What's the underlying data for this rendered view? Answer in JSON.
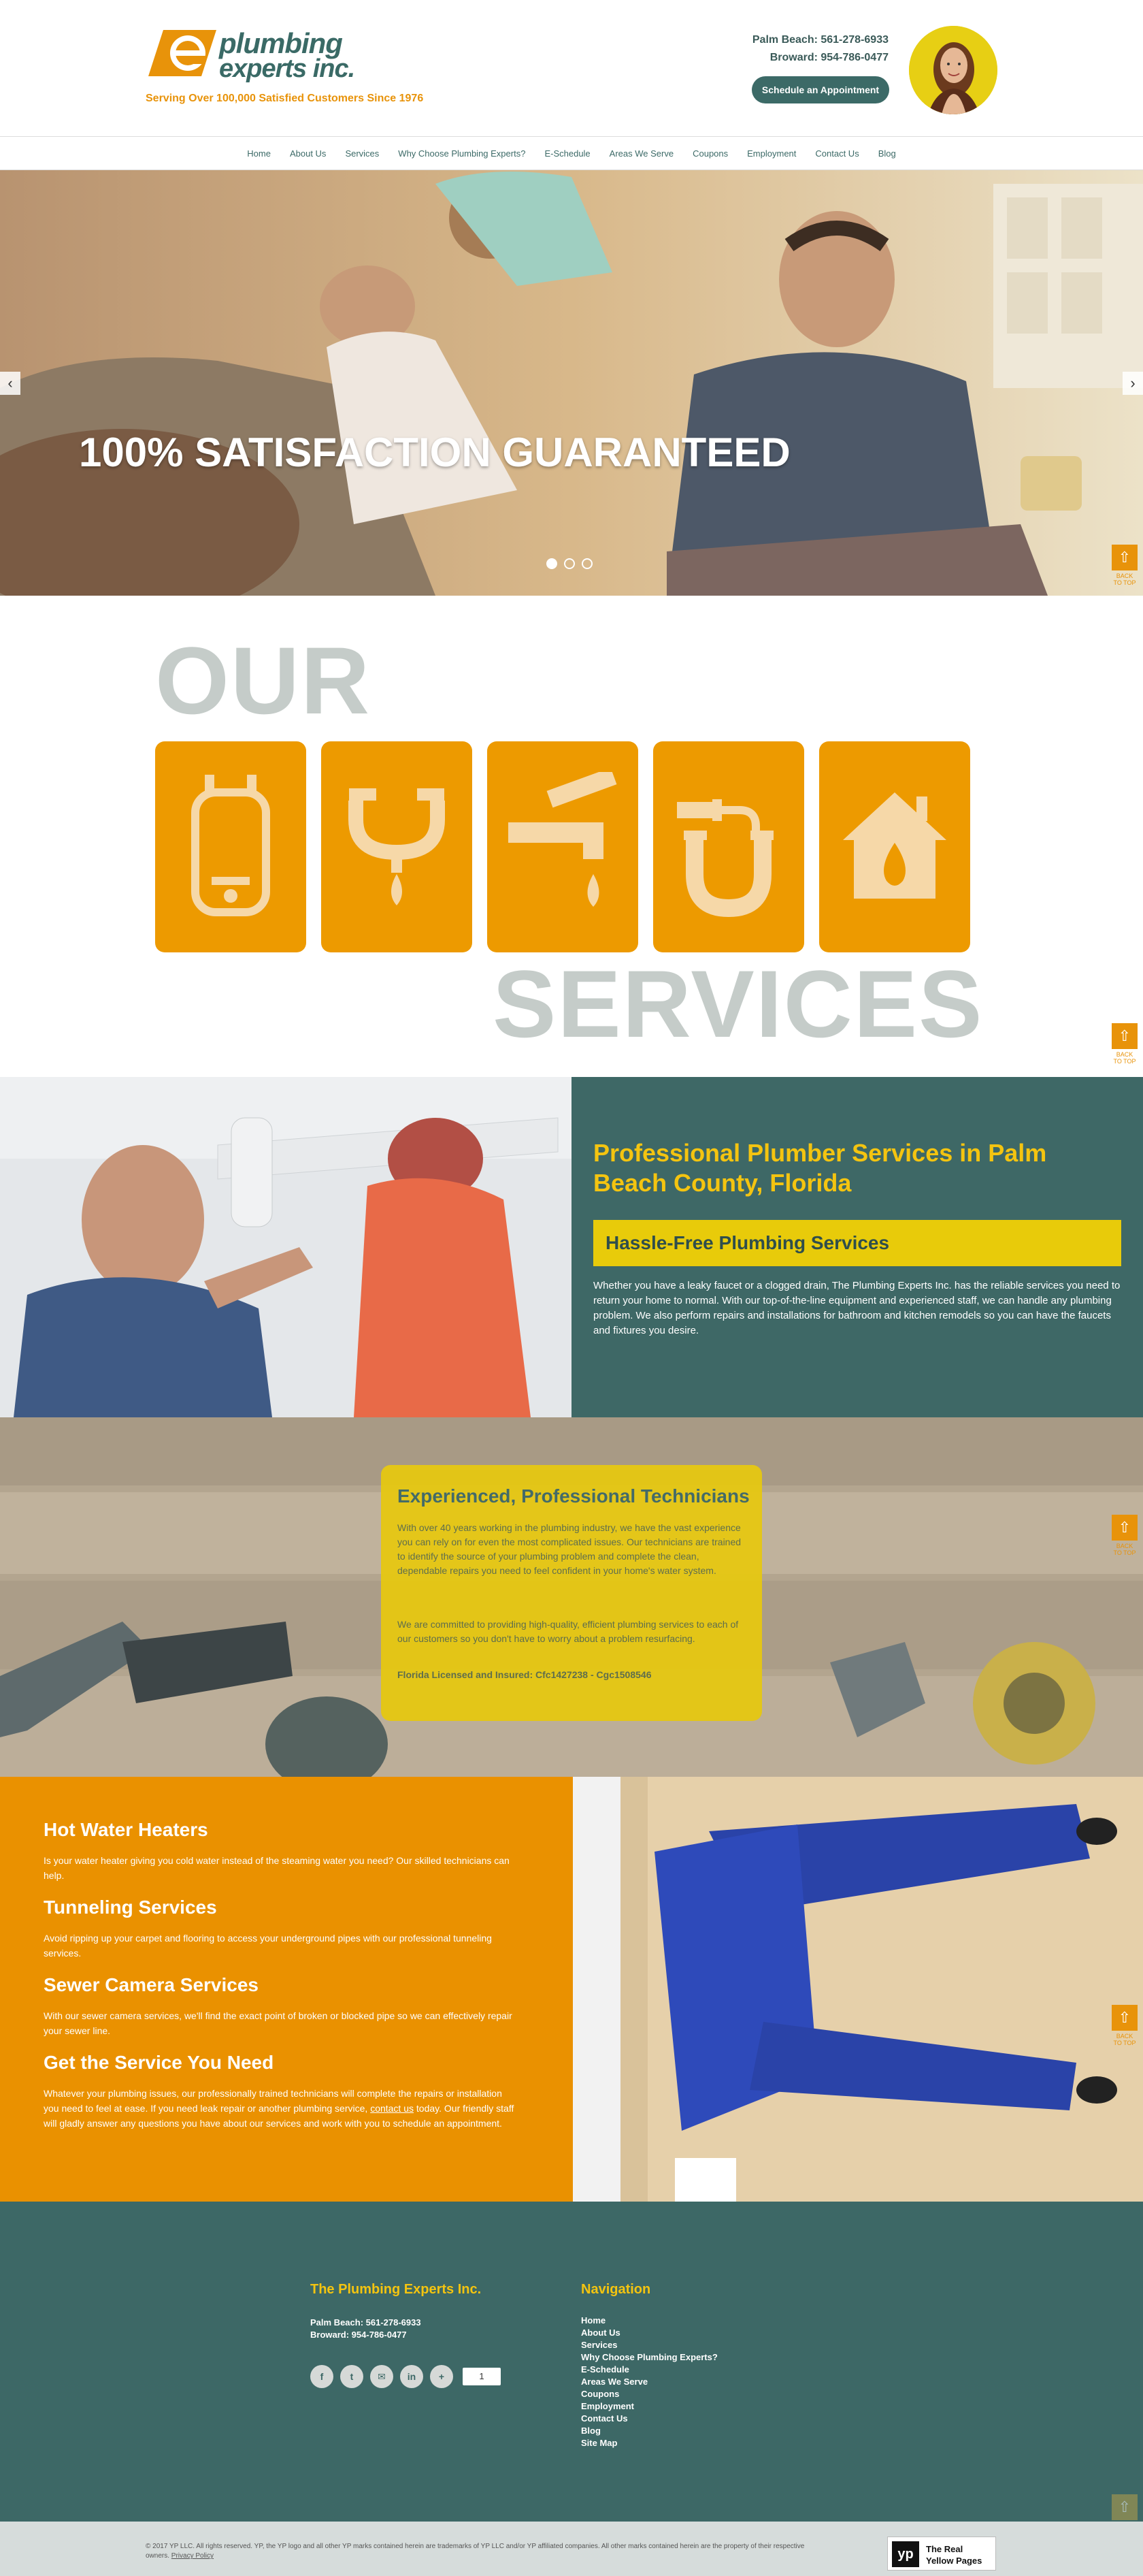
{
  "header": {
    "logo_line1": "plumbing",
    "logo_line2": "experts inc.",
    "tagline": "Serving Over 100,000 Satisfied Customers Since 1976",
    "phone_palm_beach": "Palm Beach: 561-278-6933",
    "phone_broward": "Broward: 954-786-0477",
    "appointment_button": "Schedule an Appointment"
  },
  "nav": {
    "items": [
      "Home",
      "About Us",
      "Services",
      "Why Choose Plumbing Experts?",
      "E-Schedule",
      "Areas We Serve",
      "Coupons",
      "Employment",
      "Contact Us",
      "Blog"
    ]
  },
  "hero": {
    "title": "100% SATISFACTION GUARANTEED",
    "prev_arrow": "‹",
    "next_arrow": "›",
    "slides_total": 3,
    "active_slide": 1
  },
  "back_to_top": {
    "arrow": "⇧",
    "label_line1": "BACK",
    "label_line2": "TO TOP"
  },
  "our_services": {
    "word_our": "OUR",
    "word_services": "SERVICES",
    "icons": [
      "water-heater-icon",
      "sink-drain-icon",
      "faucet-icon",
      "p-trap-pipe-icon",
      "house-water-icon"
    ]
  },
  "professional": {
    "heading": "Professional Plumber Services in Palm Beach County, Florida",
    "subheading": "Hassle-Free Plumbing Services",
    "body": "Whether you have a leaky faucet or a clogged drain, The Plumbing Experts Inc. has the reliable services you need to return your home to normal. With our top-of-the-line equipment and experienced staff, we can handle any plumbing problem. We also perform repairs and installations for bathroom and kitchen remodels so you can have the faucets and fixtures you desire."
  },
  "technicians": {
    "heading": "Experienced, Professional Technicians",
    "p1": "With over 40 years working in the plumbing industry, we have the vast experience you can rely on for even the most complicated issues. Our technicians are trained to identify the source of your plumbing problem and complete the clean, dependable repairs you need to feel confident in your home's water system.",
    "p2": "We are committed to providing high-quality, efficient plumbing services to each of our customers so you don't have to worry about a problem resurfacing.",
    "license": "Florida Licensed and Insured: Cfc1427238 - Cgc1508546"
  },
  "services_list": [
    {
      "title": "Hot Water Heaters",
      "text": "Is your water heater giving you cold water instead of the steaming water you need? Our skilled technicians can help."
    },
    {
      "title": "Tunneling Services",
      "text": "Avoid ripping up your carpet and flooring to access your underground pipes with our professional tunneling services."
    },
    {
      "title": "Sewer Camera Services",
      "text": "With our sewer camera services, we'll find the exact point of broken or blocked pipe so we can effectively repair your sewer line."
    },
    {
      "title": "Get the Service You Need",
      "text_before": "Whatever your plumbing issues, our professionally trained technicians will complete the repairs or installation you need to feel at ease. If you need leak repair or another plumbing service, ",
      "link": "contact us",
      "text_after": " today. Our friendly staff will gladly answer any questions you have about our services and work with you to schedule an appointment."
    }
  ],
  "footer": {
    "company_heading": "The Plumbing Experts Inc.",
    "phone_palm_beach": "Palm Beach: 561-278-6933",
    "phone_broward": "Broward: 954-786-0477",
    "social": [
      "f",
      "t",
      "✉",
      "in",
      "+"
    ],
    "share_count": "1",
    "nav_heading": "Navigation",
    "nav_items": [
      "Home",
      "About Us",
      "Services",
      "Why Choose Plumbing Experts?",
      "E-Schedule",
      "Areas We Serve",
      "Coupons",
      "Employment",
      "Contact Us",
      "Blog",
      "Site Map"
    ]
  },
  "bottom": {
    "legal": "© 2017 YP LLC. All rights reserved. YP, the YP logo and all other YP marks contained herein are trademarks of YP LLC and/or YP affiliated companies. All other marks contained herein are the property of their respective owners.",
    "privacy": "Privacy Policy",
    "yp_mark": "yp",
    "yp_line1": "The Real",
    "yp_line2": "Yellow Pages"
  },
  "colors": {
    "teal": "#3d6866",
    "orange": "#ea9100",
    "yellow": "#e8cb0a",
    "gray_text": "#c5ccc9"
  }
}
